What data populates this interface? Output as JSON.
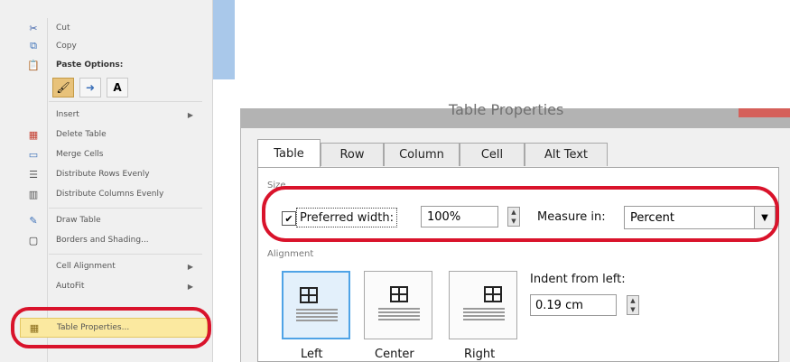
{
  "context_menu": {
    "items": [
      {
        "label": "Cut",
        "icon": "scissors-icon"
      },
      {
        "label": "Copy",
        "icon": "copy-icon"
      },
      {
        "label": "Paste Options:",
        "icon": "paste-icon"
      },
      {
        "label": "Insert",
        "icon": "",
        "submenu": true
      },
      {
        "label": "Delete Table",
        "icon": "delete-table-icon"
      },
      {
        "label": "Merge Cells",
        "icon": "merge-cells-icon"
      },
      {
        "label": "Distribute Rows Evenly",
        "icon": "distribute-rows-icon"
      },
      {
        "label": "Distribute Columns Evenly",
        "icon": "distribute-columns-icon"
      },
      {
        "label": "Draw Table",
        "icon": "draw-table-icon"
      },
      {
        "label": "Borders and Shading...",
        "icon": "borders-icon"
      },
      {
        "label": "Cell Alignment",
        "icon": "",
        "submenu": true
      },
      {
        "label": "AutoFit",
        "icon": "",
        "submenu": true
      },
      {
        "label": "Table Properties...",
        "icon": "table-properties-icon",
        "highlighted": true
      }
    ],
    "paste_options": [
      "keep-source-formatting-icon",
      "merge-formatting-icon",
      "keep-text-only-icon"
    ],
    "paste_text_only_glyph": "A"
  },
  "dialog": {
    "title": "Table Properties",
    "tabs": [
      "Table",
      "Row",
      "Column",
      "Cell",
      "Alt Text"
    ],
    "active_tab": "Table",
    "size_section": "Size",
    "preferred_width_label": "Preferred width:",
    "preferred_width_checked": true,
    "preferred_width_value": "100%",
    "measure_in_label": "Measure in:",
    "measure_in_value": "Percent",
    "alignment_section": "Alignment",
    "alignment_options": [
      "Left",
      "Center",
      "Right"
    ],
    "alignment_selected": "Left",
    "indent_label": "Indent from left:",
    "indent_value": "0.19 cm"
  },
  "colors": {
    "annotation_circle": "#d9132b",
    "highlight": "#fbe9a0",
    "active_align_border": "#4fa3e6"
  }
}
